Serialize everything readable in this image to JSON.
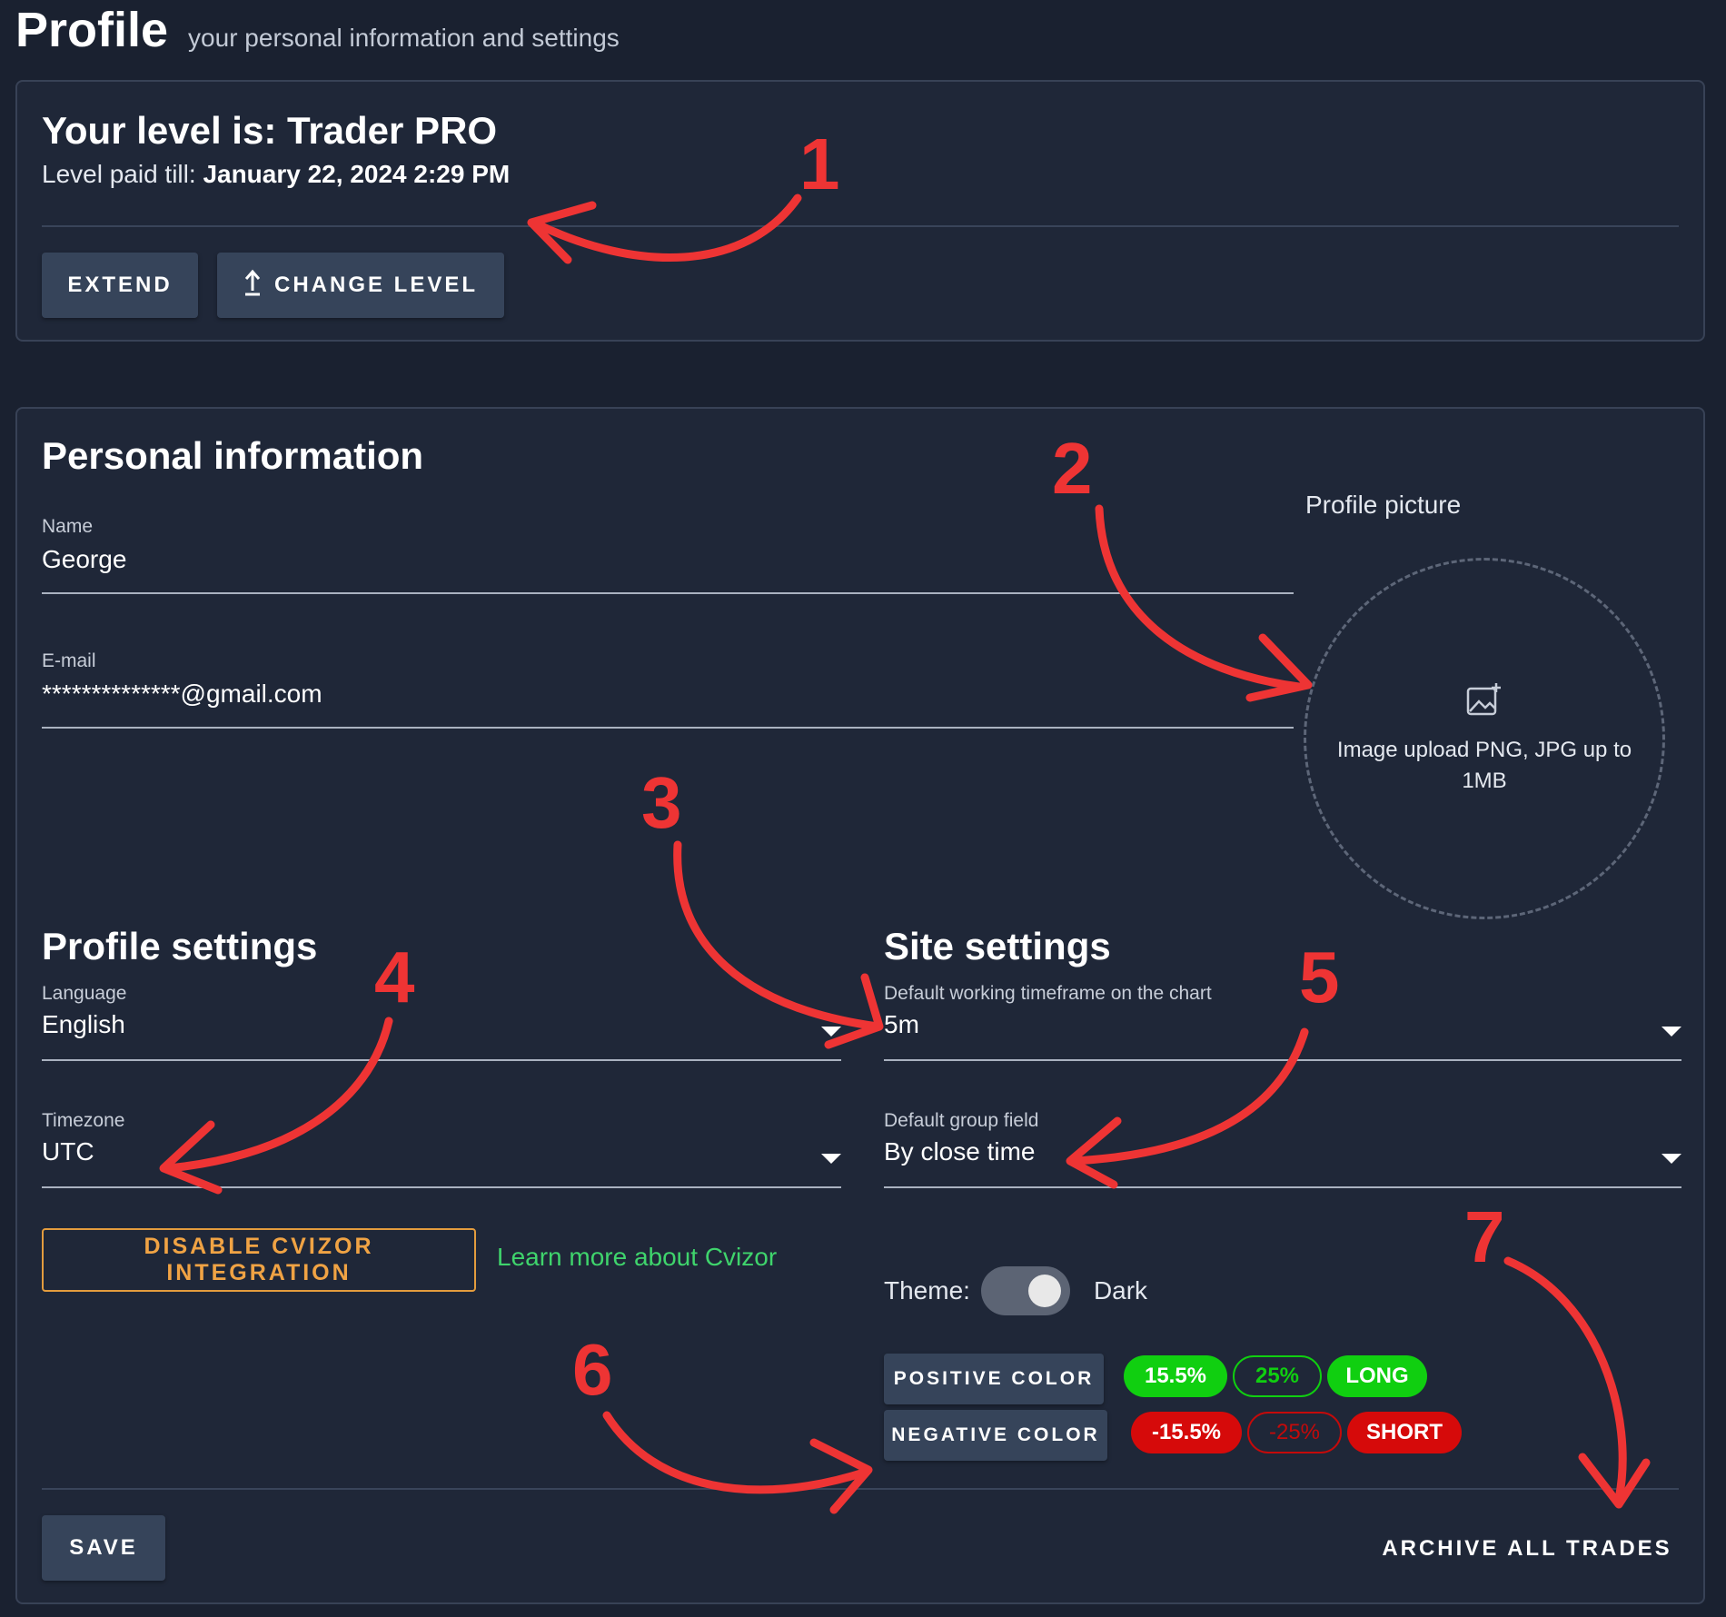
{
  "header": {
    "title": "Profile",
    "subtitle": "your personal information and settings"
  },
  "level": {
    "title": "Your level is: Trader PRO",
    "paid_label": "Level paid till:",
    "paid_value": "January 22, 2024 2:29 PM",
    "extend_label": "EXTEND",
    "change_label": "CHANGE LEVEL"
  },
  "personal": {
    "title": "Personal information",
    "name_label": "Name",
    "name_value": "George",
    "email_label": "E-mail",
    "email_value": "**************@gmail.com",
    "picture_label": "Profile picture",
    "upload_text": "Image upload PNG, JPG up to 1MB"
  },
  "profile_settings": {
    "title": "Profile settings",
    "language_label": "Language",
    "language_value": "English",
    "timezone_label": "Timezone",
    "timezone_value": "UTC",
    "disable_cvizor_label": "DISABLE CVIZOR INTEGRATION",
    "learn_more": "Learn more about Cvizor"
  },
  "site_settings": {
    "title": "Site settings",
    "timeframe_label": "Default working timeframe on the chart",
    "timeframe_value": "5m",
    "group_label": "Default group field",
    "group_value": "By close time",
    "theme_label": "Theme:",
    "theme_value": "Dark",
    "positive_color_label": "POSITIVE COLOR",
    "negative_color_label": "NEGATIVE COLOR",
    "positive_samples": [
      "15.5%",
      "25%",
      "LONG"
    ],
    "negative_samples": [
      "-15.5%",
      "-25%",
      "SHORT"
    ]
  },
  "actions": {
    "save_label": "SAVE",
    "archive_label": "ARCHIVE ALL TRADES"
  },
  "annotations": [
    "1",
    "2",
    "3",
    "4",
    "5",
    "6",
    "7"
  ],
  "colors": {
    "background": "#1a2130",
    "card": "#1f2738",
    "button": "#36445a",
    "accent_orange": "#f0a344",
    "link_green": "#3fd46c",
    "positive": "#10cf10",
    "negative": "#d60a0a",
    "annotation_red": "#ee3434"
  },
  "icons": {
    "change_level": "upload-arrow-icon",
    "upload": "image-add-icon",
    "dropdown": "caret-down-icon"
  }
}
